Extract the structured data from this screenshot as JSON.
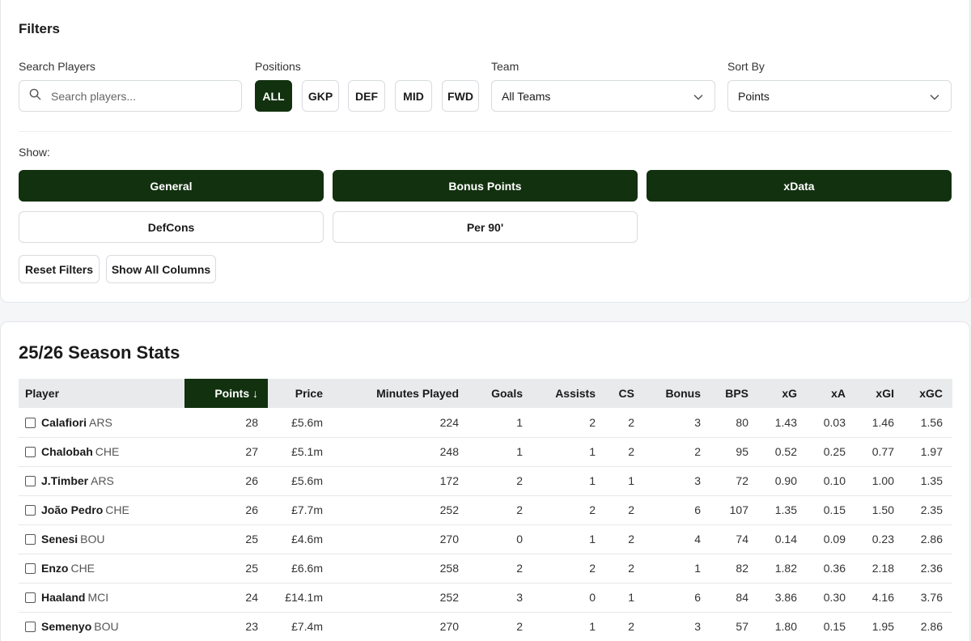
{
  "filters": {
    "title": "Filters",
    "search_label": "Search Players",
    "search_placeholder": "Search players...",
    "positions_label": "Positions",
    "positions": [
      {
        "label": "ALL"
      },
      {
        "label": "GKP"
      },
      {
        "label": "DEF"
      },
      {
        "label": "MID"
      },
      {
        "label": "FWD"
      }
    ],
    "team_label": "Team",
    "team_value": "All Teams",
    "sort_label": "Sort By",
    "sort_value": "Points",
    "show_label": "Show:",
    "show_options": [
      {
        "label": "General"
      },
      {
        "label": "Bonus Points"
      },
      {
        "label": "xData"
      },
      {
        "label": "DefCons"
      },
      {
        "label": "Per 90'"
      }
    ],
    "reset_label": "Reset Filters",
    "show_all_label": "Show All Columns"
  },
  "stats": {
    "title": "25/26 Season Stats",
    "columns": [
      "Player",
      "Points ↓",
      "Price",
      "Minutes Played",
      "Goals",
      "Assists",
      "CS",
      "Bonus",
      "BPS",
      "xG",
      "xA",
      "xGI",
      "xGC"
    ],
    "rows": [
      {
        "name": "Calafiori",
        "team": "ARS",
        "points": "28",
        "price": "£5.6m",
        "minutes": "224",
        "goals": "1",
        "assists": "2",
        "cs": "2",
        "bonus": "3",
        "bps": "80",
        "xg": "1.43",
        "xa": "0.03",
        "xgi": "1.46",
        "xgc": "1.56"
      },
      {
        "name": "Chalobah",
        "team": "CHE",
        "points": "27",
        "price": "£5.1m",
        "minutes": "248",
        "goals": "1",
        "assists": "1",
        "cs": "2",
        "bonus": "2",
        "bps": "95",
        "xg": "0.52",
        "xa": "0.25",
        "xgi": "0.77",
        "xgc": "1.97"
      },
      {
        "name": "J.Timber",
        "team": "ARS",
        "points": "26",
        "price": "£5.6m",
        "minutes": "172",
        "goals": "2",
        "assists": "1",
        "cs": "1",
        "bonus": "3",
        "bps": "72",
        "xg": "0.90",
        "xa": "0.10",
        "xgi": "1.00",
        "xgc": "1.35"
      },
      {
        "name": "João Pedro",
        "team": "CHE",
        "points": "26",
        "price": "£7.7m",
        "minutes": "252",
        "goals": "2",
        "assists": "2",
        "cs": "2",
        "bonus": "6",
        "bps": "107",
        "xg": "1.35",
        "xa": "0.15",
        "xgi": "1.50",
        "xgc": "2.35"
      },
      {
        "name": "Senesi",
        "team": "BOU",
        "points": "25",
        "price": "£4.6m",
        "minutes": "270",
        "goals": "0",
        "assists": "1",
        "cs": "2",
        "bonus": "4",
        "bps": "74",
        "xg": "0.14",
        "xa": "0.09",
        "xgi": "0.23",
        "xgc": "2.86"
      },
      {
        "name": "Enzo",
        "team": "CHE",
        "points": "25",
        "price": "£6.6m",
        "minutes": "258",
        "goals": "2",
        "assists": "2",
        "cs": "2",
        "bonus": "1",
        "bps": "82",
        "xg": "1.82",
        "xa": "0.36",
        "xgi": "2.18",
        "xgc": "2.36"
      },
      {
        "name": "Haaland",
        "team": "MCI",
        "points": "24",
        "price": "£14.1m",
        "minutes": "252",
        "goals": "3",
        "assists": "0",
        "cs": "1",
        "bonus": "6",
        "bps": "84",
        "xg": "3.86",
        "xa": "0.30",
        "xgi": "4.16",
        "xgc": "3.76"
      },
      {
        "name": "Semenyo",
        "team": "BOU",
        "points": "23",
        "price": "£7.4m",
        "minutes": "270",
        "goals": "2",
        "assists": "1",
        "cs": "2",
        "bonus": "3",
        "bps": "57",
        "xg": "1.80",
        "xa": "0.15",
        "xgi": "1.95",
        "xgc": "2.86"
      }
    ]
  },
  "colors": {
    "accent": "#12310f",
    "header_bg": "#e9eaec"
  }
}
